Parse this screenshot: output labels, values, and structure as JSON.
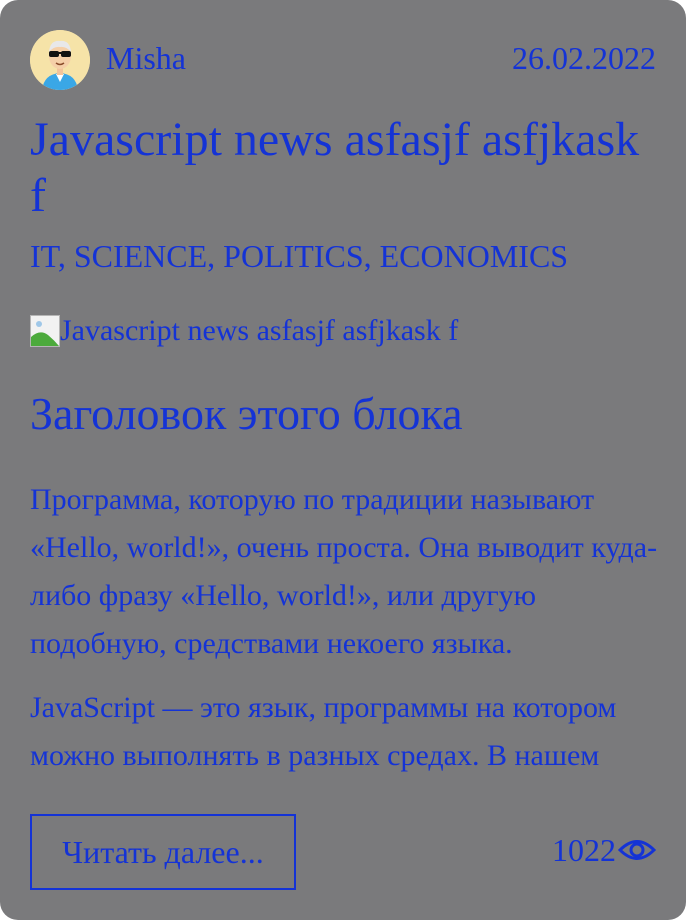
{
  "post": {
    "author": "Misha",
    "avatar_icon": "avatar-cartoon-sunglasses",
    "date": "26.02.2022",
    "title": "Javascript news asfasjf asfjkask f",
    "categories": "IT, SCIENCE, POLITICS, ECONOMICS",
    "image_alt": "Javascript news asfasjf asfjkask f",
    "block_title": "Заголовок этого блока",
    "paragraphs": [
      "Программа, которую по традиции называют «Hello, world!», очень проста. Она выводит куда-либо фразу «Hello, world!», или другую подобную, средствами некоего языка.",
      "JavaScript — это язык, программы на котором можно выполнять в разных средах. В нашем случае речь идёт о браузерах и о серверной платформе Node.js."
    ],
    "read_more_label": "Читать далее...",
    "views": "1022",
    "views_icon": "eye-icon"
  },
  "colors": {
    "card_background": "#7a7a7c",
    "accent_text": "#1433d6"
  }
}
